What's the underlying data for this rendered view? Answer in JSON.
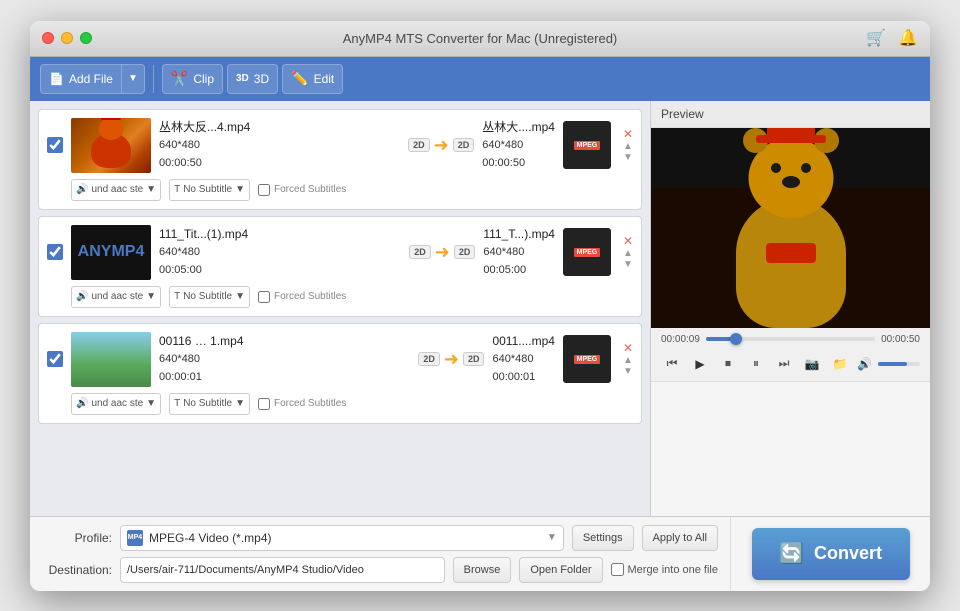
{
  "window": {
    "title": "AnyMP4 MTS Converter for Mac (Unregistered)"
  },
  "toolbar": {
    "add_file": "Add File",
    "clip": "Clip",
    "threed": "3D",
    "edit": "Edit"
  },
  "files": [
    {
      "id": 1,
      "input_name": "丛林大反...4.mp4",
      "input_res": "640*480",
      "input_dur": "00:00:50",
      "output_name": "丛林大....mp4",
      "output_res": "640*480",
      "output_dur": "00:00:50",
      "audio": "und aac ste",
      "subtitle": "No Subtitle",
      "forced": "Forced Subtitles",
      "has_thumb": true,
      "thumb_class": "thumb-1"
    },
    {
      "id": 2,
      "input_name": "111_Tit...(1).mp4",
      "input_res": "640*480",
      "input_dur": "00:05:00",
      "output_name": "111_T...).mp4",
      "output_res": "640*480",
      "output_dur": "00:05:00",
      "audio": "und aac ste",
      "subtitle": "No Subtitle",
      "forced": "Forced Subtitles",
      "has_thumb": false,
      "thumb_class": "thumb-2"
    },
    {
      "id": 3,
      "input_name": "00116 … 1.mp4",
      "input_res": "640*480",
      "input_dur": "00:00:01",
      "output_name": "0011....mp4",
      "output_res": "640*480",
      "output_dur": "00:00:01",
      "audio": "und aac ste",
      "subtitle": "No Subtitle",
      "forced": "Forced Subtitles",
      "has_thumb": true,
      "thumb_class": "thumb-3"
    }
  ],
  "preview": {
    "title": "Preview",
    "current_time": "00:00:09",
    "total_time": "00:00:50",
    "progress_pct": 18
  },
  "bottom": {
    "profile_label": "Profile:",
    "profile_icon": "MP4",
    "profile_value": "MPEG-4 Video (*.mp4)",
    "settings_label": "Settings",
    "apply_all_label": "Apply to All",
    "dest_label": "Destination:",
    "dest_value": "/Users/air-711/Documents/AnyMP4 Studio/Video",
    "browse_label": "Browse",
    "open_folder_label": "Open Folder",
    "merge_label": "Merge into one file"
  },
  "convert": {
    "label": "Convert"
  }
}
